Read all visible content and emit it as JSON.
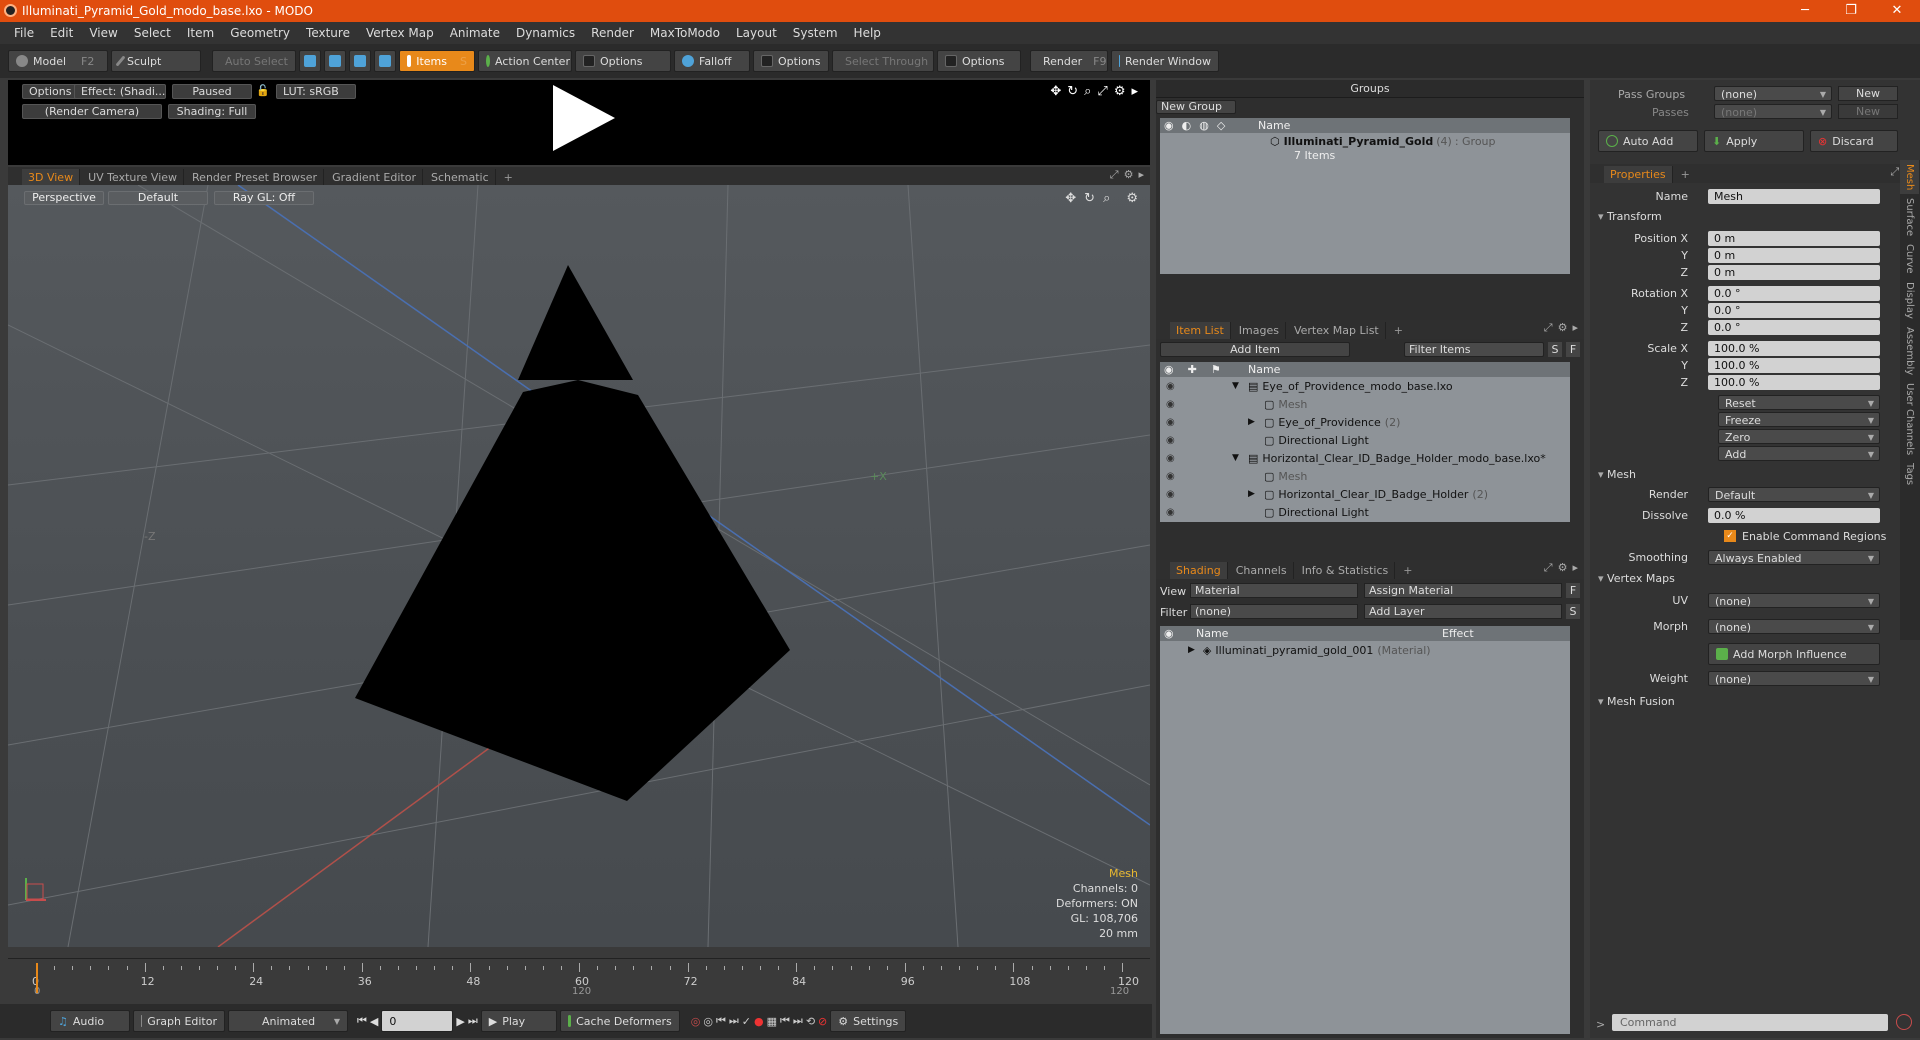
{
  "window": {
    "title": "Illuminati_Pyramid_Gold_modo_base.lxo - MODO",
    "min": "─",
    "max": "❐",
    "close": "✕"
  },
  "menu": [
    "File",
    "Edit",
    "View",
    "Select",
    "Item",
    "Geometry",
    "Texture",
    "Vertex Map",
    "Animate",
    "Dynamics",
    "Render",
    "MaxToModo",
    "Layout",
    "System",
    "Help"
  ],
  "toolbar": {
    "model": "Model",
    "model_key": "F2",
    "sculpt": "Sculpt",
    "auto_select": "Auto Select",
    "items": "Items",
    "items_key": "S",
    "action_center": "Action Center",
    "options1": "Options",
    "falloff": "Falloff",
    "options2": "Options",
    "select_through": "Select Through",
    "options3": "Options",
    "render": "Render",
    "render_key": "F9",
    "render_window": "Render Window"
  },
  "preview": {
    "options": "Options",
    "effect": "Effect: (Shadi...",
    "paused": "Paused",
    "lut": "LUT: sRGB",
    "camera": "(Render Camera)",
    "shading": "Shading: Full"
  },
  "viewtabs": [
    "3D View",
    "UV Texture View",
    "Render Preset Browser",
    "Gradient Editor",
    "Schematic",
    "+"
  ],
  "viewport": {
    "perspective": "Perspective",
    "default": "Default",
    "raygl": "Ray GL: Off",
    "axis_neg_z": "-Z",
    "axis_pos_x": "+X",
    "info_title": "Mesh",
    "channels": "Channels: 0",
    "deformers": "Deformers: ON",
    "gl": "GL: 108,706",
    "unit": "20 mm"
  },
  "timeline": {
    "labels": [
      "0",
      "12",
      "24",
      "36",
      "48",
      "60",
      "72",
      "84",
      "96",
      "108",
      "120"
    ],
    "start": "0",
    "mid": "120",
    "end": "120"
  },
  "bottombar": {
    "audio": "Audio",
    "graph": "Graph Editor",
    "animated": "Animated",
    "frame": "0",
    "play": "Play",
    "cache": "Cache Deformers",
    "settings": "Settings"
  },
  "groups": {
    "title": "Groups",
    "new_group": "New Group",
    "col_name": "Name",
    "group_name": "Illuminati_Pyramid_Gold",
    "group_count": "(4)",
    "group_type": ": Group",
    "group_items": "7 Items"
  },
  "itemlist": {
    "tabs": [
      "Item List",
      "Images",
      "Vertex Map List",
      "+"
    ],
    "add_item": "Add Item",
    "filter": "Filter Items",
    "s": "S",
    "f": "F",
    "col_name": "Name",
    "rows": [
      {
        "name": "Eye_of_Providence_modo_base.lxo",
        "indent": 0,
        "arrow": "▼",
        "gray": false
      },
      {
        "name": "Mesh",
        "indent": 1,
        "arrow": "",
        "gray": true
      },
      {
        "name": "Eye_of_Providence",
        "extra": "(2)",
        "indent": 1,
        "arrow": "▶",
        "gray": false
      },
      {
        "name": "Directional Light",
        "indent": 1,
        "arrow": "",
        "gray": false
      },
      {
        "name": "Horizontal_Clear_ID_Badge_Holder_modo_base.lxo*",
        "indent": 0,
        "arrow": "▼",
        "gray": false
      },
      {
        "name": "Mesh",
        "indent": 1,
        "arrow": "",
        "gray": true
      },
      {
        "name": "Horizontal_Clear_ID_Badge_Holder",
        "extra": "(2)",
        "indent": 1,
        "arrow": "▶",
        "gray": false
      },
      {
        "name": "Directional Light",
        "indent": 1,
        "arrow": "",
        "gray": false
      }
    ]
  },
  "shading": {
    "tabs": [
      "Shading",
      "Channels",
      "Info & Statistics",
      "+"
    ],
    "view_label": "View",
    "view_value": "Material",
    "assign": "Assign Material",
    "f": "F",
    "filter_label": "Filter",
    "filter_value": "(none)",
    "add_layer": "Add Layer",
    "s": "S",
    "col_name": "Name",
    "col_effect": "Effect",
    "material": "Illuminati_pyramid_gold_001",
    "material_type": "(Material)"
  },
  "props": {
    "pass_groups": "Pass Groups",
    "passes": "Passes",
    "none": "(none)",
    "new": "New",
    "auto_add": "Auto Add",
    "apply": "Apply",
    "discard": "Discard",
    "tab": "Properties",
    "plus": "+",
    "name_label": "Name",
    "name_value": "Mesh",
    "transform": "Transform",
    "pos_x_label": "Position X",
    "y": "Y",
    "z": "Z",
    "zero_m": "0 m",
    "rot_x_label": "Rotation X",
    "zero_deg": "0.0 °",
    "scale_x_label": "Scale X",
    "hundred": "100.0 %",
    "reset": "Reset",
    "freeze": "Freeze",
    "zero": "Zero",
    "add": "Add",
    "mesh_section": "Mesh",
    "render_label": "Render",
    "render_value": "Default",
    "dissolve_label": "Dissolve",
    "dissolve_value": "0.0 %",
    "enable_cmd": "Enable Command Regions",
    "smoothing_label": "Smoothing",
    "smoothing_value": "Always Enabled",
    "vmaps": "Vertex Maps",
    "uv_label": "UV",
    "morph_label": "Morph",
    "add_morph": "Add Morph Influence",
    "weight_label": "Weight",
    "mesh_fusion": "Mesh Fusion",
    "vtabs": [
      "Mesh",
      "Surface",
      "Curve",
      "Display",
      "Assembly",
      "User Channels",
      "Tags"
    ],
    "command": "Command"
  }
}
